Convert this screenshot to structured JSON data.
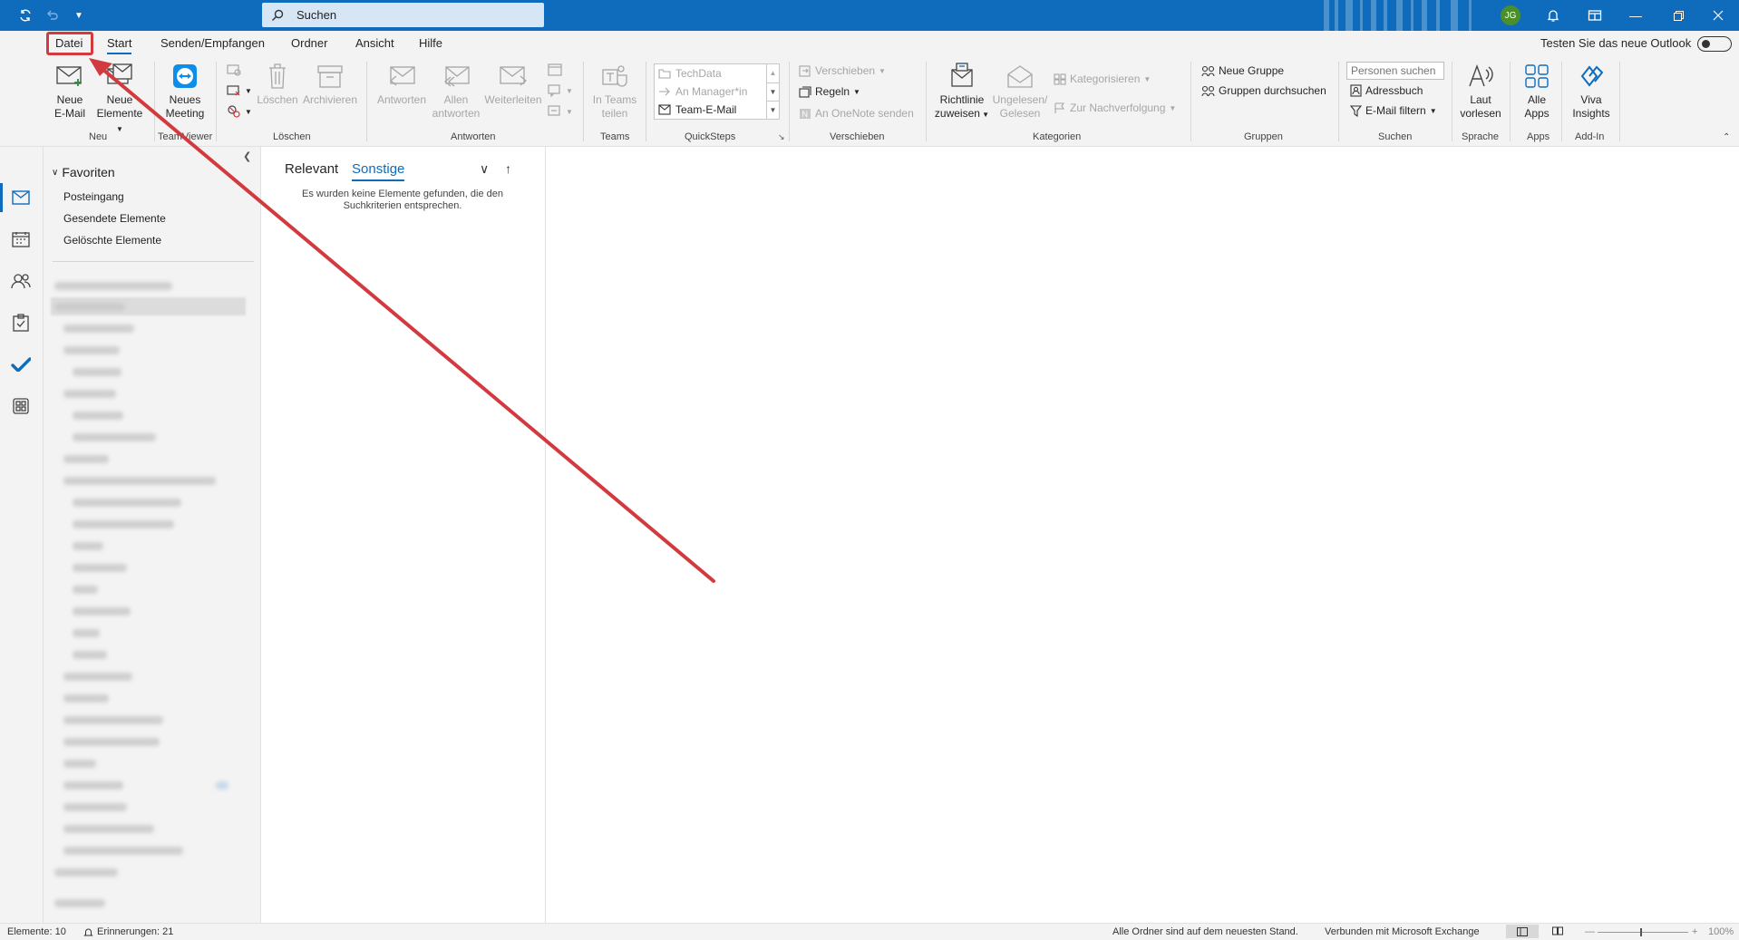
{
  "titlebar": {
    "search_placeholder": "Suchen",
    "avatar_initials": "JG"
  },
  "tabs": [
    {
      "label": "Datei"
    },
    {
      "label": "Start"
    },
    {
      "label": "Senden/Empfangen"
    },
    {
      "label": "Ordner"
    },
    {
      "label": "Ansicht"
    },
    {
      "label": "Hilfe"
    }
  ],
  "try_outlook": "Testen Sie das neue Outlook",
  "ribbon": {
    "neu": {
      "label": "Neu",
      "new_email": "Neue\nE-Mail",
      "new_items": "Neue\nElemente"
    },
    "teamviewer": {
      "label": "TeamViewer",
      "new_meeting": "Neues\nMeeting"
    },
    "loeschen": {
      "label": "Löschen",
      "delete": "Löschen",
      "archive": "Archivieren"
    },
    "antworten": {
      "label": "Antworten",
      "reply": "Antworten",
      "reply_all": "Allen\nantworten",
      "forward": "Weiterleiten"
    },
    "teams": {
      "label": "Teams",
      "share": "In Teams\nteilen"
    },
    "quicksteps": {
      "label": "QuickSteps",
      "items": [
        "TechData",
        "An Manager*in",
        "Team-E-Mail"
      ]
    },
    "verschieben": {
      "label": "Verschieben",
      "move": "Verschieben",
      "rules": "Regeln",
      "onenote": "An OneNote senden"
    },
    "kategorien": {
      "label": "Kategorien",
      "policy": "Richtlinie\nzuweisen",
      "unread": "Ungelesen/\nGelesen",
      "categorize": "Kategorisieren",
      "followup": "Zur Nachverfolgung"
    },
    "gruppen": {
      "label": "Gruppen",
      "new_group": "Neue Gruppe",
      "browse": "Gruppen durchsuchen"
    },
    "suchen": {
      "label": "Suchen",
      "people_placeholder": "Personen suchen",
      "address_book": "Adressbuch",
      "filter": "E-Mail filtern"
    },
    "sprache": {
      "label": "Sprache",
      "read_aloud": "Laut\nvorlesen"
    },
    "apps": {
      "label": "Apps",
      "all_apps": "Alle\nApps"
    },
    "addin": {
      "label": "Add-In",
      "viva": "Viva\nInsights"
    }
  },
  "folders": {
    "favorites_title": "Favoriten",
    "favorites": [
      "Posteingang",
      "Gesendete Elemente",
      "Gelöschte Elemente"
    ]
  },
  "message_list": {
    "tab_relevant": "Relevant",
    "tab_other": "Sonstige",
    "empty_text": "Es wurden keine Elemente gefunden, die den Suchkriterien entsprechen."
  },
  "statusbar": {
    "items": "Elemente: 10",
    "reminders": "Erinnerungen: 21",
    "sync_status": "Alle Ordner sind auf dem neuesten Stand.",
    "connection": "Verbunden mit Microsoft Exchange",
    "zoom": "100%"
  },
  "colors": {
    "accent": "#0f6cbd",
    "highlight": "#d33a3f"
  }
}
